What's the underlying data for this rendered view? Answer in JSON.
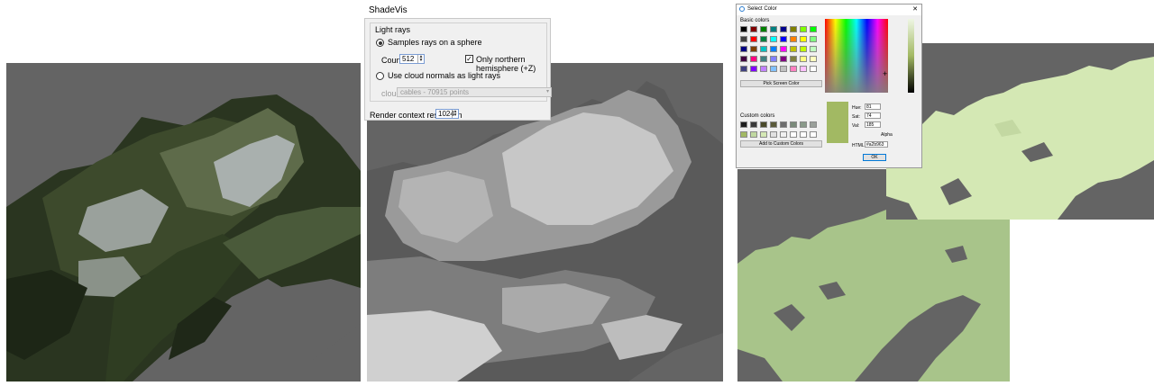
{
  "shadevis": {
    "title": "ShadeVis",
    "group_title": "Light rays",
    "option_sphere": "Samples rays on a sphere",
    "count_label": "Count",
    "count_value": "512",
    "northern_label": "Only northern hemisphere (+Z)",
    "northern_checked": true,
    "option_normals": "Use cloud normals as light rays",
    "cloud_label": "cloud",
    "cloud_value": "cables - 70915 points",
    "resolution_label": "Render context resolution",
    "resolution_value": "1024"
  },
  "color_dialog": {
    "title": "Select Color",
    "basic_colors_label": "Basic colors",
    "pick_screen_label": "Pick Screen Color",
    "custom_colors_label": "Custom colors",
    "add_custom_label": "Add to Custom Colors",
    "hue_label": "Hue:",
    "hue_value": "81",
    "sat_label": "Sat:",
    "sat_value": "74",
    "val_label": "Val:",
    "val_value": "185",
    "alpha_label": "Alpha",
    "html_label": "HTML:",
    "html_value": "#a2b963",
    "ok_label": "OK",
    "selected_color": "#a2b963",
    "close_icon": "close-icon"
  },
  "colors": {
    "background_gray": "#646464",
    "tint_green": "#a8c48a",
    "tint_light_green": "#d4e8b4"
  }
}
